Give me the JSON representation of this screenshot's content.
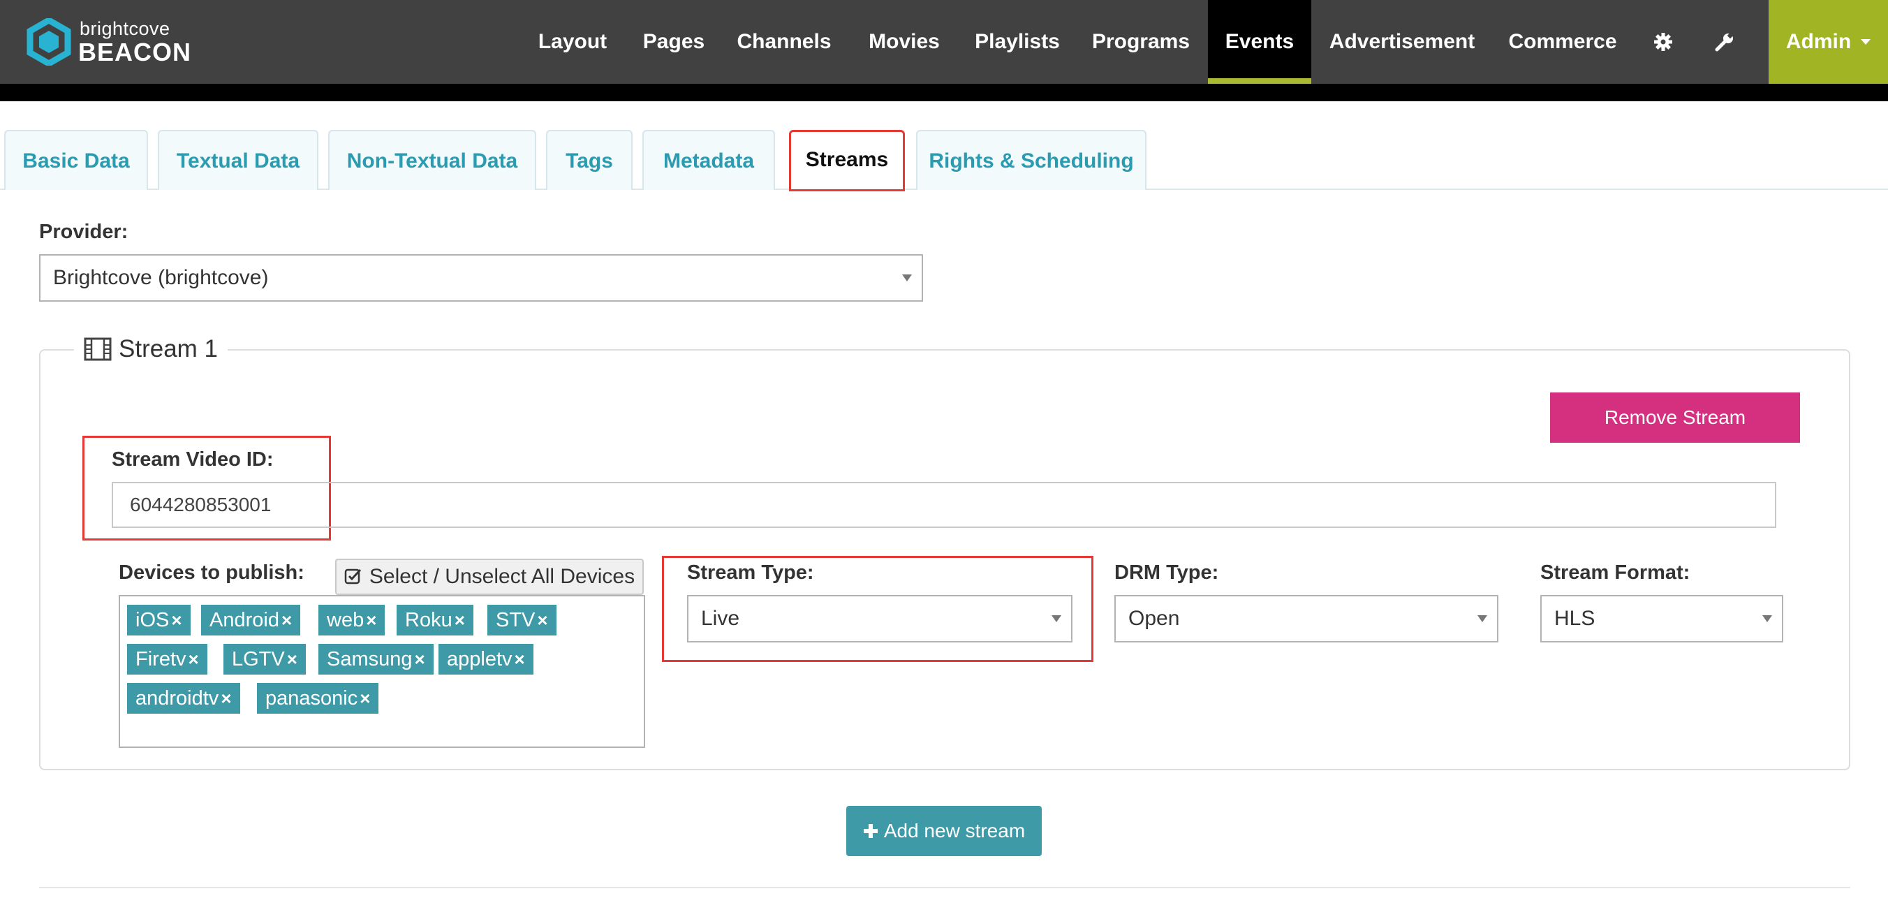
{
  "brand": {
    "small": "brightcove",
    "big": "BEACON"
  },
  "nav": {
    "items": [
      {
        "label": "Layout"
      },
      {
        "label": "Pages"
      },
      {
        "label": "Channels"
      },
      {
        "label": "Movies"
      },
      {
        "label": "Playlists"
      },
      {
        "label": "Programs"
      },
      {
        "label": "Events"
      },
      {
        "label": "Advertisement"
      },
      {
        "label": "Commerce"
      }
    ],
    "active": "Events",
    "icons": [
      "gear-icon",
      "wrench-icon"
    ],
    "user": "Admin"
  },
  "tabs": [
    {
      "label": "Basic Data"
    },
    {
      "label": "Textual Data"
    },
    {
      "label": "Non-Textual Data"
    },
    {
      "label": "Tags"
    },
    {
      "label": "Metadata"
    },
    {
      "label": "Streams"
    },
    {
      "label": "Rights & Scheduling"
    }
  ],
  "active_tab": "Streams",
  "provider": {
    "label": "Provider:",
    "value": "Brightcove (brightcove)"
  },
  "stream": {
    "legend": "Stream 1",
    "remove_label": "Remove Stream",
    "video_id_label": "Stream Video ID:",
    "video_id_value": "6044280853001",
    "devices_label": "Devices to publish:",
    "select_all_label": "Select / Unselect All Devices",
    "devices": [
      {
        "label": "iOS"
      },
      {
        "label": "Android"
      },
      {
        "label": "web"
      },
      {
        "label": "Roku"
      },
      {
        "label": "STV"
      },
      {
        "label": "Firetv"
      },
      {
        "label": "LGTV"
      },
      {
        "label": "Samsung"
      },
      {
        "label": "appletv"
      },
      {
        "label": "androidtv"
      },
      {
        "label": "panasonic"
      }
    ],
    "chip_remove_glyph": "×",
    "stream_type": {
      "label": "Stream Type:",
      "value": "Live"
    },
    "drm_type": {
      "label": "DRM Type:",
      "value": "Open"
    },
    "stream_format": {
      "label": "Stream Format:",
      "value": "HLS"
    }
  },
  "add_stream_label": "Add new stream",
  "colors": {
    "nav_bg": "#414141",
    "admin_bg": "#a1b424",
    "active_underline": "#a9b932",
    "tab_text": "#2a9bb0",
    "remove_button": "#d4307f",
    "chip_bg": "#3f9aa7",
    "highlight": "#e53935"
  }
}
